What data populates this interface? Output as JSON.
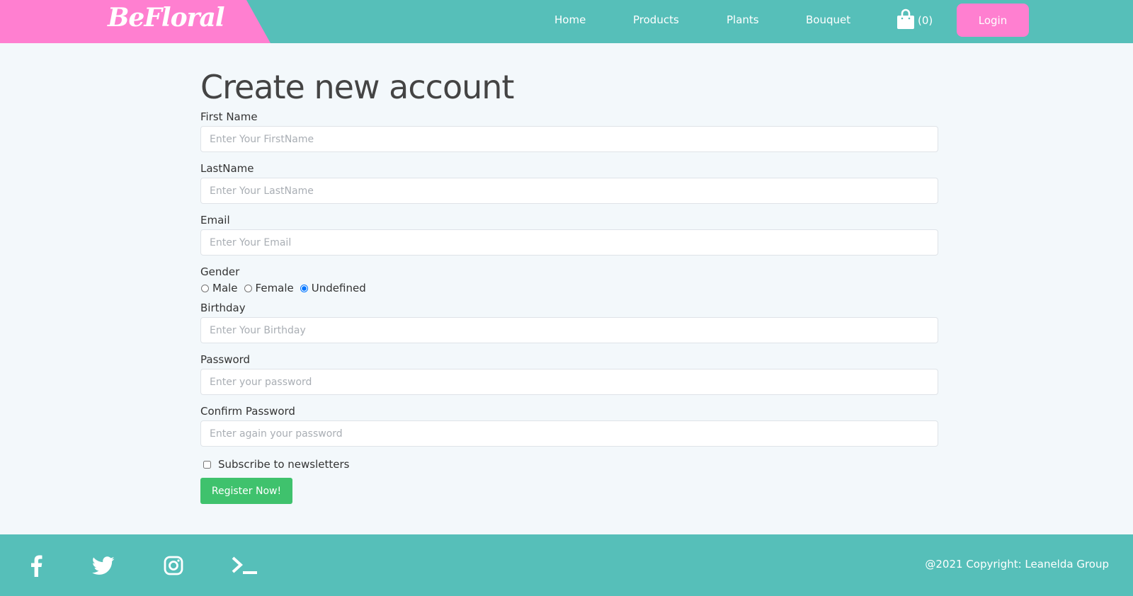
{
  "brand": {
    "name": "BeFloral"
  },
  "nav": {
    "items": [
      {
        "label": "Home"
      },
      {
        "label": "Products"
      },
      {
        "label": "Plants"
      },
      {
        "label": "Bouquet"
      }
    ],
    "cart_count": "(0)",
    "login_label": "Login"
  },
  "form": {
    "title": "Create new account",
    "first_name": {
      "label": "First Name",
      "placeholder": "Enter Your FirstName",
      "value": ""
    },
    "last_name": {
      "label": "LastName",
      "placeholder": "Enter Your LastName",
      "value": ""
    },
    "email": {
      "label": "Email",
      "placeholder": "Enter Your Email",
      "value": ""
    },
    "gender": {
      "label": "Gender",
      "options": [
        "Male",
        "Female",
        "Undefined"
      ],
      "selected": "Undefined"
    },
    "birthday": {
      "label": "Birthday",
      "placeholder": "Enter Your Birthday",
      "value": ""
    },
    "password": {
      "label": "Password",
      "placeholder": "Enter your password",
      "value": ""
    },
    "confirm_password": {
      "label": "Confirm Password",
      "placeholder": "Enter again your password",
      "value": ""
    },
    "newsletter": {
      "label": "Subscribe to newsletters",
      "checked": false
    },
    "submit_label": "Register Now!"
  },
  "footer": {
    "social_icons": [
      "facebook-icon",
      "twitter-icon",
      "instagram-icon",
      "terminal-icon"
    ],
    "copyright": "@2021 Copyright: Leanelda Group"
  },
  "colors": {
    "header_teal": "#56bfb9",
    "brand_pink": "#ff7fd0",
    "register_green": "#3fc26d",
    "page_background": "#f3f8fb"
  }
}
